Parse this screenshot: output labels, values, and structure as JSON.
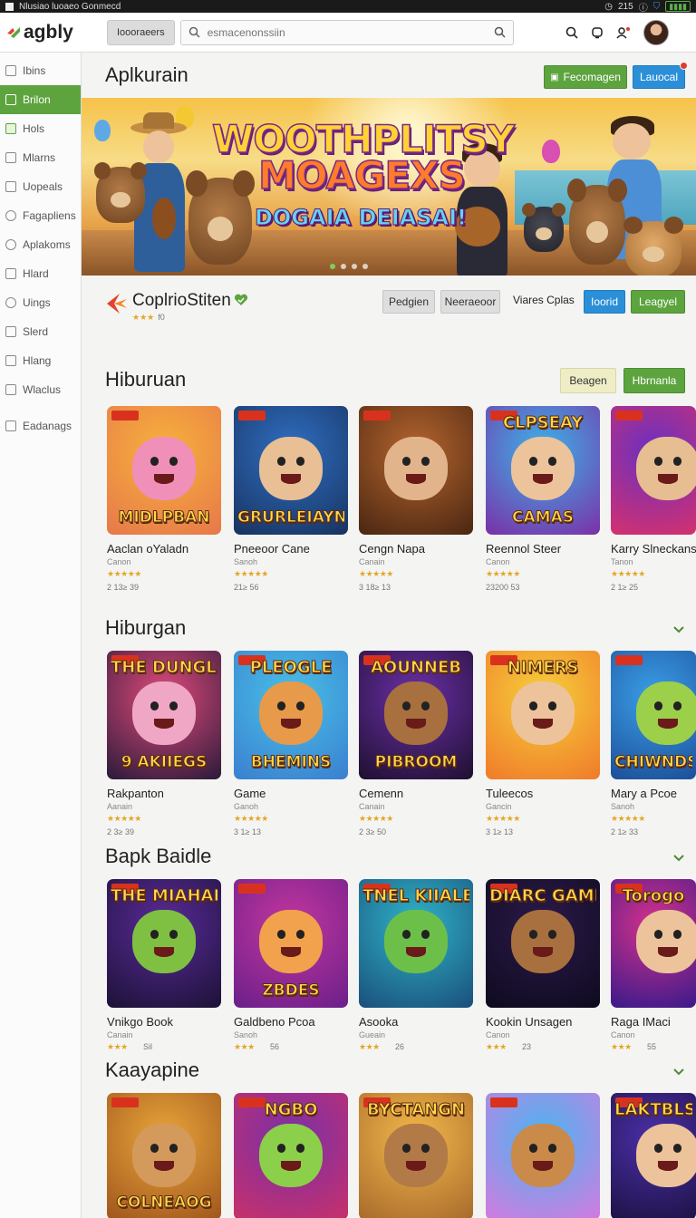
{
  "statusbar": {
    "title": "Nlusiao luoaeo Gonmecd",
    "time": "215"
  },
  "header": {
    "logo": "agbly",
    "tab_chip": "Ioooraeers",
    "search_placeholder": "esmacenonssiin"
  },
  "sidebar": {
    "items": [
      {
        "label": "Ibins"
      },
      {
        "label": "Brilon"
      },
      {
        "label": "Hols"
      },
      {
        "label": "Mlarns"
      },
      {
        "label": "Uopeals"
      },
      {
        "label": "Fagapliens"
      },
      {
        "label": "Aplakoms"
      },
      {
        "label": "Hlard"
      },
      {
        "label": "Uings"
      },
      {
        "label": "Slerd"
      },
      {
        "label": "Hlang"
      },
      {
        "label": "Wlaclus"
      },
      {
        "label": "Eadanags"
      }
    ]
  },
  "page": {
    "title": "Aplkurain",
    "action_primary": "Fecomagen",
    "action_secondary": "Lauocal"
  },
  "banner": {
    "title_line1": "WOOTHPLITSY",
    "title_line2": "MOAGEXS",
    "subtitle": "DOGAIA DEIASAI!",
    "slide_count": 4,
    "active_slide": 1
  },
  "developer": {
    "name": "CoplrioStiten",
    "rating_text": "★★★",
    "rating_count": "f0",
    "btn_gray1": "Pedgien",
    "btn_gray2": "Neeraeoor",
    "link": "Viares Cplas",
    "btn_blue": "Ioorid",
    "btn_green": "Leagyel"
  },
  "sections": [
    {
      "title": "Hiburuan",
      "btn_cream": "Beagen",
      "btn_green": "Hbrnanla",
      "cards": [
        {
          "name": "Aaclan oYaladn",
          "sub": "Canon",
          "stars": "★★★★★",
          "count": "2 13≥ 39",
          "thumb_title": "MIDLPBAN",
          "colors": [
            "#f7b13c",
            "#e6784a"
          ],
          "figure": "#f08fb8"
        },
        {
          "name": "Pneeoor Cane",
          "sub": "Sanoh",
          "stars": "★★★★★",
          "count": "21≥ 56",
          "thumb_title": "GRURLEIAYN",
          "colors": [
            "#2f6fc2",
            "#18325f"
          ],
          "figure": "#e9bf95"
        },
        {
          "name": "Cengn Napa",
          "sub": "Canain",
          "stars": "★★★★★",
          "count": "3 18≥ 13",
          "thumb_title": "",
          "colors": [
            "#b5652d",
            "#4a2612"
          ],
          "figure": "#e2b48c"
        },
        {
          "name": "Reennol Steer",
          "sub": "Canon",
          "stars": "★★★★★",
          "count": "23200 53",
          "thumb_title": "CAMAS",
          "thumb_title_top": "CLPSEAY",
          "colors": [
            "#3bb4e8",
            "#7b2fa8"
          ],
          "figure": "#ecc39b"
        },
        {
          "name": "Karry Slneckans",
          "sub": "Tanon",
          "stars": "★★★★★",
          "count": "2 1≥ 25",
          "thumb_title": "",
          "colors": [
            "#6b2fc0",
            "#d4316e"
          ],
          "figure": "#e7bd92"
        }
      ]
    },
    {
      "title": "Hiburgan",
      "cards": [
        {
          "name": "Rakpanton",
          "sub": "Aanain",
          "stars": "★★★★★",
          "count": "2 3≥ 39",
          "thumb_title": "9 AKIIEGS",
          "thumb_title_top": "THE DUNGLSN",
          "colors": [
            "#e04a7a",
            "#2a1a3a"
          ],
          "figure": "#f0a7c5"
        },
        {
          "name": "Game",
          "sub": "Ganoh",
          "stars": "★★★★★",
          "count": "3 1≥ 13",
          "thumb_title": "BHEMINS",
          "thumb_title_top": "PLEOGLE",
          "colors": [
            "#48c0e6",
            "#3a7fd0"
          ],
          "figure": "#e69a4a"
        },
        {
          "name": "Cemenn",
          "sub": "Canain",
          "stars": "★★★★★",
          "count": "2 3≥ 50",
          "thumb_title": "PIBROOM",
          "thumb_title_top": "AOUNNEB",
          "colors": [
            "#6b2fa8",
            "#1e1030"
          ],
          "figure": "#a8703e"
        },
        {
          "name": "Tuleecos",
          "sub": "Gancin",
          "stars": "★★★★★",
          "count": "3 1≥ 13",
          "thumb_title": "",
          "thumb_title_top": "NIMERS",
          "colors": [
            "#f6d03a",
            "#f07a2a"
          ],
          "figure": "#ecc39b"
        },
        {
          "name": "Mary a Pcoe",
          "sub": "Sanoh",
          "stars": "★★★★★",
          "count": "2 1≥ 33",
          "thumb_title": "CHIWNDS",
          "colors": [
            "#3a9ee6",
            "#1c4f9a"
          ],
          "figure": "#9ccf4a"
        }
      ]
    },
    {
      "title": "Bapk Baidle",
      "cards": [
        {
          "name": "Vnikgo Book",
          "sub": "Canain",
          "stars": "★★★",
          "count": "Sil",
          "thumb_title": "",
          "thumb_title_top": "THE MIAHALON",
          "colors": [
            "#5a2a9a",
            "#1c1236"
          ],
          "figure": "#7fc043"
        },
        {
          "name": "Galdbeno Pcoa",
          "sub": "Sanoh",
          "stars": "★★★",
          "count": "56",
          "thumb_title": "ZBDES",
          "colors": [
            "#c2369e",
            "#6b1f8a"
          ],
          "figure": "#f2a24c"
        },
        {
          "name": "Asooka",
          "sub": "Gueain",
          "stars": "★★★",
          "count": "26",
          "thumb_title": "",
          "thumb_title_top": "TNEL KIIALBAL",
          "colors": [
            "#2fb4c8",
            "#1a4f7a"
          ],
          "figure": "#6cc04a"
        },
        {
          "name": "Kookin Unsagen",
          "sub": "Canon",
          "stars": "★★★",
          "count": "23",
          "thumb_title": "",
          "thumb_title_top": "DIARC GAMES",
          "colors": [
            "#2b1a4a",
            "#0e0a1e"
          ],
          "figure": "#a8703e"
        },
        {
          "name": "Raga IMaci",
          "sub": "Canon",
          "stars": "★★★",
          "count": "55",
          "thumb_title": "",
          "thumb_title_top": "Torogo",
          "colors": [
            "#d4318a",
            "#3a1a8a"
          ],
          "figure": "#ecc39b"
        }
      ]
    },
    {
      "title": "Kaayapine",
      "cards": [
        {
          "name": "",
          "sub": "",
          "stars": "",
          "count": "",
          "thumb_title": "COLNEAOG",
          "colors": [
            "#e8a53a",
            "#a0551c"
          ],
          "figure": "#d49a5c"
        },
        {
          "name": "",
          "sub": "",
          "stars": "",
          "count": "",
          "thumb_title": "",
          "thumb_title_top": "NGBO",
          "colors": [
            "#7a2fa8",
            "#c8316a"
          ],
          "figure": "#8ccf4a"
        },
        {
          "name": "",
          "sub": "",
          "stars": "",
          "count": "",
          "thumb_title": "",
          "thumb_title_top": "BYCTANGN",
          "colors": [
            "#f2b84a",
            "#a86a2c"
          ],
          "figure": "#b27a46"
        },
        {
          "name": "",
          "sub": "",
          "stars": "",
          "count": "",
          "thumb_title": "",
          "colors": [
            "#4ab4f0",
            "#d47adf"
          ],
          "figure": "#c98a4a"
        },
        {
          "name": "",
          "sub": "",
          "stars": "",
          "count": "",
          "thumb_title": "",
          "thumb_title_top": "LAKTBLS",
          "colors": [
            "#4a2fa8",
            "#1e1246"
          ],
          "figure": "#ecc39b"
        }
      ]
    }
  ],
  "colors": {
    "accent_green": "#5da43f",
    "accent_blue": "#2b8fd8",
    "star": "#e3a725"
  }
}
